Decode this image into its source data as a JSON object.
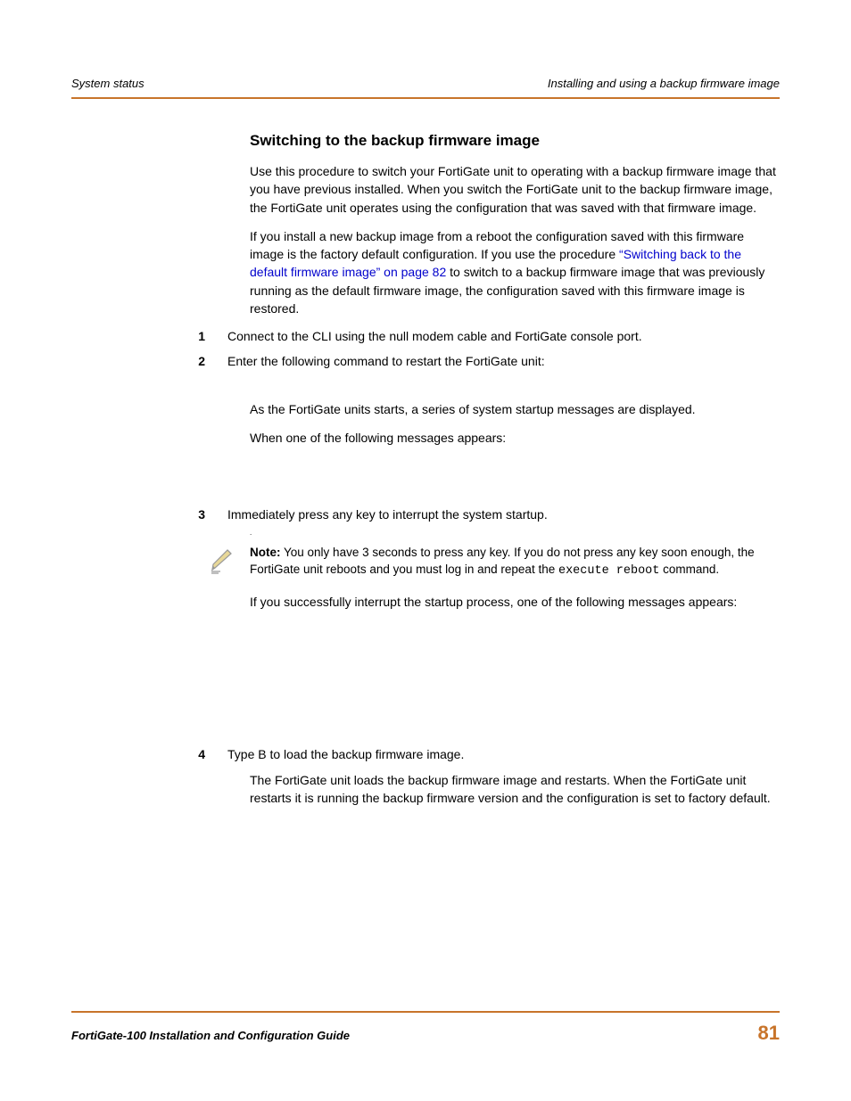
{
  "header": {
    "left": "System status",
    "right": "Installing and using a backup firmware image"
  },
  "heading": "Switching to the backup firmware image",
  "para1": "Use this procedure to switch your FortiGate unit to operating with a backup firmware image that you have previous installed. When you switch the FortiGate unit to the backup firmware image, the FortiGate unit operates using the configuration that was saved with that firmware image.",
  "para2_pre": "If you install a new backup image from a reboot the configuration saved with this firmware image is the factory default configuration. If you use the procedure ",
  "para2_link": "“Switching back to the default firmware image” on page 82",
  "para2_post": " to switch to a backup firmware image that was previously running as the default firmware image, the configuration saved with this firmware image is restored.",
  "step1_num": "1",
  "step1_text": "Connect to the CLI using the null modem cable and FortiGate console port.",
  "step2_num": "2",
  "step2_text": "Enter the following command to restart the FortiGate unit:",
  "after2_a": "As the FortiGate units starts, a series of system startup messages are displayed.",
  "after2_b": "When one of the following messages appears:",
  "step3_num": "3",
  "step3_text": "Immediately press any key to interrupt the system startup.",
  "dot": ".",
  "note_label": "Note:",
  "note_a": " You only have 3 seconds to press any key. If you do not press any key soon enough, the FortiGate unit reboots and you must log in and repeat the ",
  "note_cmd": "execute reboot",
  "note_b": " command.",
  "after3": "If you successfully interrupt the startup process, one of the following messages appears:",
  "step4_num": "4",
  "step4_text": "Type B to load the backup firmware image.",
  "after4": "The FortiGate unit loads the backup firmware image and restarts. When the FortiGate unit restarts it is running the backup firmware version and the configuration is set to factory default.",
  "footer": {
    "title": "FortiGate-100 Installation and Configuration Guide",
    "page": "81"
  }
}
